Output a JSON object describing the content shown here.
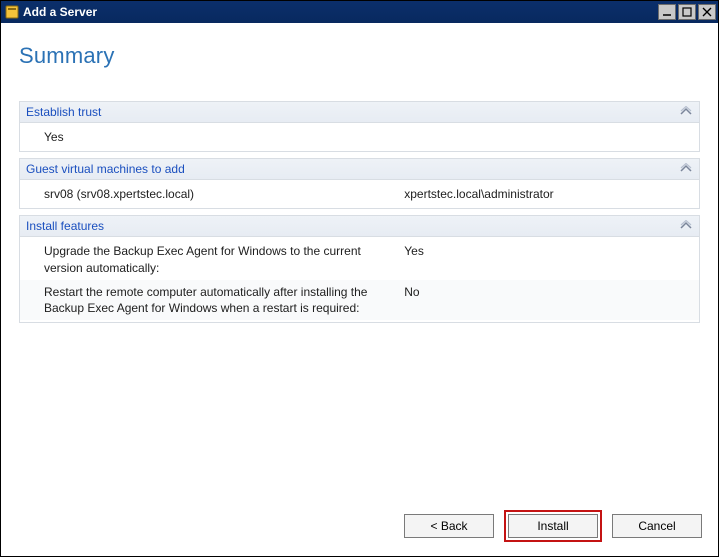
{
  "window": {
    "title": "Add a Server"
  },
  "page": {
    "heading": "Summary"
  },
  "sections": {
    "trust": {
      "title": "Establish trust",
      "rows": [
        {
          "label": "Yes",
          "value": ""
        }
      ]
    },
    "guests": {
      "title": "Guest virtual machines to add",
      "rows": [
        {
          "label": "srv08 (srv08.xpertstec.local)",
          "value": "xpertstec.local\\administrator"
        }
      ]
    },
    "features": {
      "title": "Install features",
      "rows": [
        {
          "label": "Upgrade the Backup Exec Agent for Windows to the current version automatically:",
          "value": "Yes"
        },
        {
          "label": "Restart the remote computer automatically after installing the Backup Exec Agent for Windows when a restart is required:",
          "value": "No"
        }
      ]
    }
  },
  "buttons": {
    "back": "< Back",
    "install": "Install",
    "cancel": "Cancel"
  }
}
